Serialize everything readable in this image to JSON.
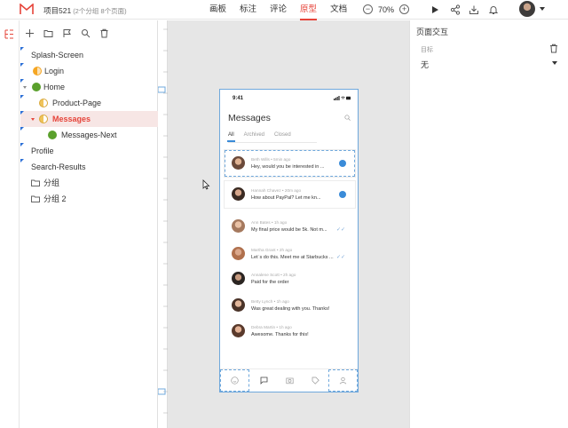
{
  "topbar": {
    "project_name": "项目521",
    "project_sub": "(2个分组 8个页面)",
    "tabs": [
      {
        "label": "画板",
        "active": false
      },
      {
        "label": "标注",
        "active": false
      },
      {
        "label": "评论",
        "active": false
      },
      {
        "label": "原型",
        "active": true
      },
      {
        "label": "文档",
        "active": false
      }
    ],
    "zoom": "70%",
    "minus": "−",
    "plus": "+",
    "accent": "#e6443a"
  },
  "pages": {
    "items": [
      {
        "label": "Splash-Screen",
        "icon": "none"
      },
      {
        "label": "Login",
        "icon": "half-circle-orange-icon"
      },
      {
        "label": "Home",
        "icon": "check-circle-green-icon"
      },
      {
        "label": "Product-Page",
        "icon": "half-circle-yellow-icon"
      },
      {
        "label": "Messages",
        "icon": "half-circle-yellow-icon",
        "selected": true
      },
      {
        "label": "Messages-Next",
        "icon": "check-circle-green-icon"
      },
      {
        "label": "Profile",
        "icon": "none"
      },
      {
        "label": "Search-Results",
        "icon": "none"
      },
      {
        "label": "分组",
        "icon": "folder-icon"
      },
      {
        "label": "分组 2",
        "icon": "folder-icon"
      }
    ]
  },
  "phone": {
    "time": "9:41",
    "title": "Messages",
    "tabs": [
      {
        "label": "All",
        "active": true
      },
      {
        "label": "Archived",
        "active": false
      },
      {
        "label": "Closed",
        "active": false
      }
    ],
    "messages": [
      {
        "name": "Beth Wills • 5min ago",
        "text": "Hey, would you be interested in ...",
        "status": "dot"
      },
      {
        "name": "Hannah Chavez • 20m ago",
        "text": "How about PayPal? Let me kn...",
        "status": "dot"
      },
      {
        "name": "Ann Bates • 1h ago",
        "text": "My final price would be 5k. Not m...",
        "status": "check"
      },
      {
        "name": "Martha Grant • 2h ago",
        "text": "Let`s do this. Meet me at Starbucks ...",
        "status": "check"
      },
      {
        "name": "Annalene Scott • 2h ago",
        "text": "Paid for the order",
        "status": "none"
      },
      {
        "name": "Betty Lynch • 1h ago",
        "text": "Was great dealing with you. Thanks!",
        "status": "none"
      },
      {
        "name": "Debra Martin • 1h ago",
        "text": "Awesome. Thanks for this!",
        "status": "none"
      }
    ],
    "check_glyph": "✓✓"
  },
  "interaction_panel": {
    "title": "页面交互",
    "target_label": "目标",
    "target_value": "无"
  }
}
